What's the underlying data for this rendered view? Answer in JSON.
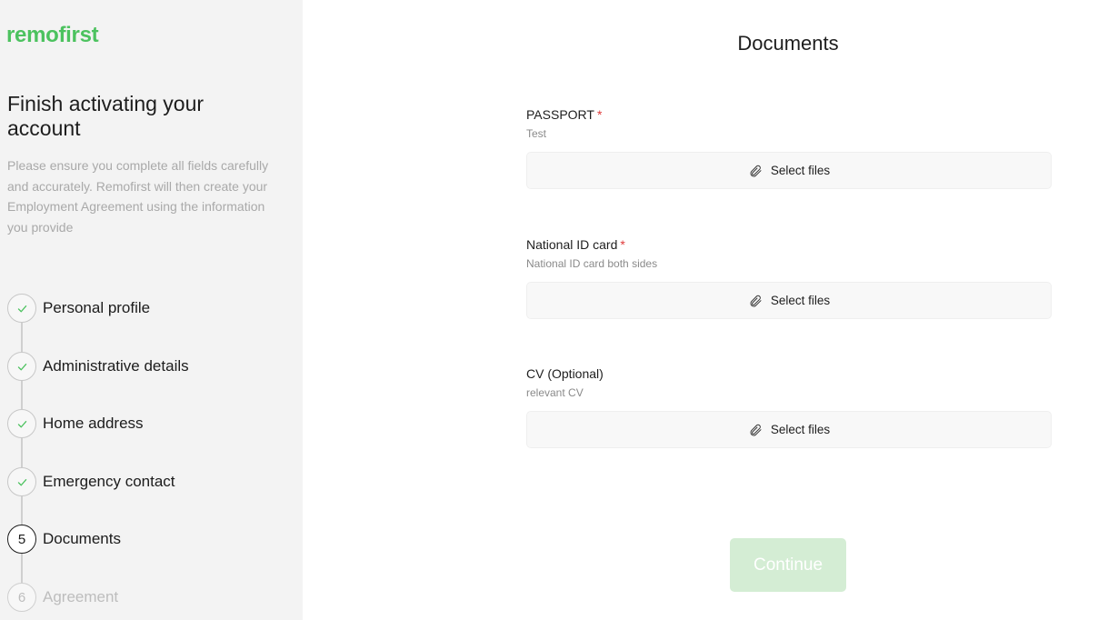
{
  "brand": {
    "logo_text": "remofirst",
    "accent_color": "#4cc25f"
  },
  "sidebar": {
    "heading": "Finish activating your account",
    "description": "Please ensure you complete all fields carefully and accurately. Remofirst will then create your Employment Agreement using the information you provide",
    "steps": [
      {
        "label": "Personal profile",
        "status": "completed",
        "icon": "check-icon"
      },
      {
        "label": "Administrative details",
        "status": "completed",
        "icon": "check-icon"
      },
      {
        "label": "Home address",
        "status": "completed",
        "icon": "check-icon"
      },
      {
        "label": "Emergency contact",
        "status": "completed",
        "icon": "check-icon"
      },
      {
        "label": "Documents",
        "status": "active",
        "number": "5"
      },
      {
        "label": "Agreement",
        "status": "pending",
        "number": "6"
      }
    ]
  },
  "main": {
    "title": "Documents",
    "fields": [
      {
        "label": "PASSPORT",
        "required": "*",
        "hint": "Test",
        "button_label": "Select files",
        "icon": "paperclip-icon"
      },
      {
        "label": "National ID card",
        "required": "*",
        "hint": "National ID card both sides",
        "button_label": "Select files",
        "icon": "paperclip-icon"
      },
      {
        "label": "CV (Optional)",
        "required": "",
        "hint": "relevant CV",
        "button_label": "Select files",
        "icon": "paperclip-icon"
      }
    ],
    "continue_label": "Continue",
    "continue_state": "disabled"
  }
}
